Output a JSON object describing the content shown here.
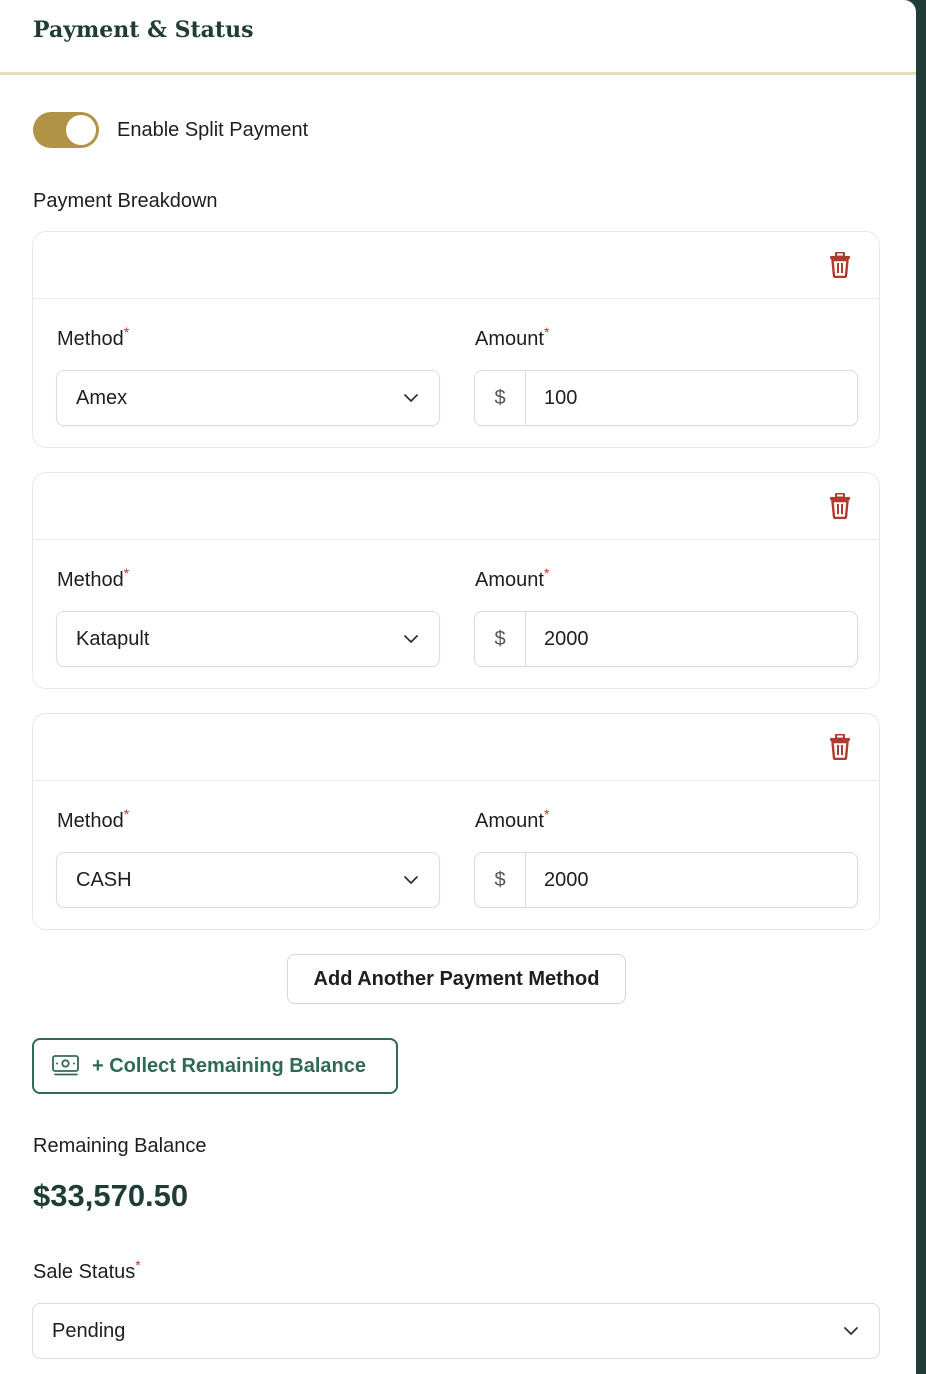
{
  "header": {
    "title": "Payment & Status"
  },
  "split_payment": {
    "label": "Enable Split Payment",
    "enabled": true
  },
  "breakdown": {
    "label": "Payment Breakdown",
    "method_label": "Method",
    "amount_label": "Amount",
    "required_mark": "*",
    "currency_symbol": "$",
    "payments": [
      {
        "method": "Amex",
        "amount": "100"
      },
      {
        "method": "Katapult",
        "amount": "2000"
      },
      {
        "method": "CASH",
        "amount": "2000"
      }
    ]
  },
  "actions": {
    "add_method": "Add Another Payment Method",
    "collect_balance": "+ Collect Remaining Balance"
  },
  "balance": {
    "label": "Remaining Balance",
    "value": "$33,570.50"
  },
  "sale_status": {
    "label": "Sale Status",
    "required_mark": "*",
    "value": "Pending"
  },
  "colors": {
    "accent_gold": "#b19346",
    "brand_green": "#1f3d36",
    "button_green": "#2f6a57",
    "danger_red": "#b03a2e"
  }
}
